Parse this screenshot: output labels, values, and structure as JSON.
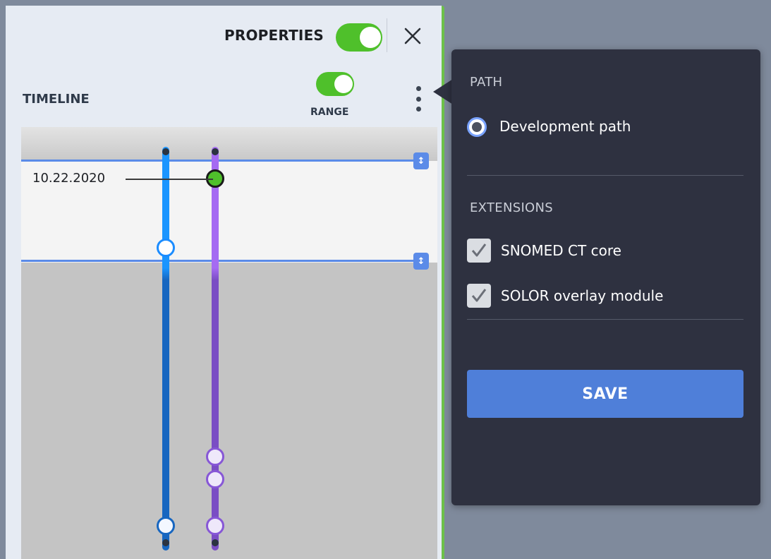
{
  "properties_panel": {
    "title": "PROPERTIES",
    "properties_toggle_on": true,
    "close_icon": "close-icon"
  },
  "timeline": {
    "label": "TIMELINE",
    "range_label": "RANGE",
    "range_toggle_on": true,
    "menu_icon": "kebab-menu-icon",
    "selected_date": "10.22.2020",
    "colors": {
      "blue_track": "#1b95ff",
      "purple_track": "#a56bf2",
      "range_line": "#5b8be8",
      "selected_node": "#4fc02b"
    }
  },
  "popover": {
    "path_section_title": "PATH",
    "path_option": "Development path",
    "path_selected": true,
    "extensions_section_title": "EXTENSIONS",
    "extensions": [
      {
        "label": "SNOMED CT core",
        "checked": true
      },
      {
        "label": "SOLOR overlay module",
        "checked": true
      }
    ],
    "save_label": "SAVE",
    "colors": {
      "background": "#2e3140",
      "save_button": "#4f7fd9"
    }
  }
}
